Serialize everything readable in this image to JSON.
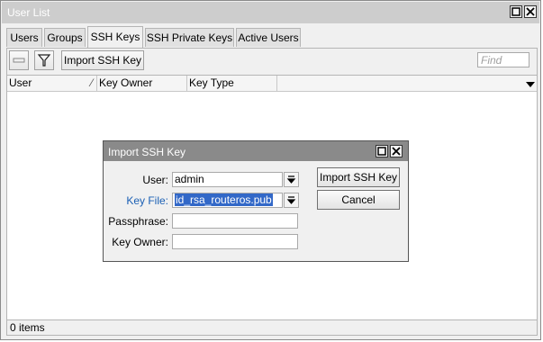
{
  "window": {
    "title": "User List"
  },
  "tabs": [
    {
      "label": "Users"
    },
    {
      "label": "Groups"
    },
    {
      "label": "SSH Keys"
    },
    {
      "label": "SSH Private Keys"
    },
    {
      "label": "Active Users"
    }
  ],
  "toolbar": {
    "remove_icon": "minus-icon",
    "filter_icon": "filter-icon",
    "import_label": "Import SSH Key",
    "find_placeholder": "Find"
  },
  "grid": {
    "columns": [
      {
        "label": "User"
      },
      {
        "label": "Key Owner"
      },
      {
        "label": "Key Type"
      }
    ],
    "rows": []
  },
  "status": {
    "items_text": "0 items"
  },
  "dialog": {
    "title": "Import SSH Key",
    "user_label": "User:",
    "user_value": "admin",
    "keyfile_label": "Key File:",
    "keyfile_value": "id_rsa_routeros.pub",
    "passphrase_label": "Passphrase:",
    "passphrase_value": "",
    "keyowner_label": "Key Owner:",
    "keyowner_value": "",
    "import_button": "Import SSH Key",
    "cancel_button": "Cancel"
  },
  "colors": {
    "accent": "#1a5fb4",
    "selection": "#3268c8"
  }
}
